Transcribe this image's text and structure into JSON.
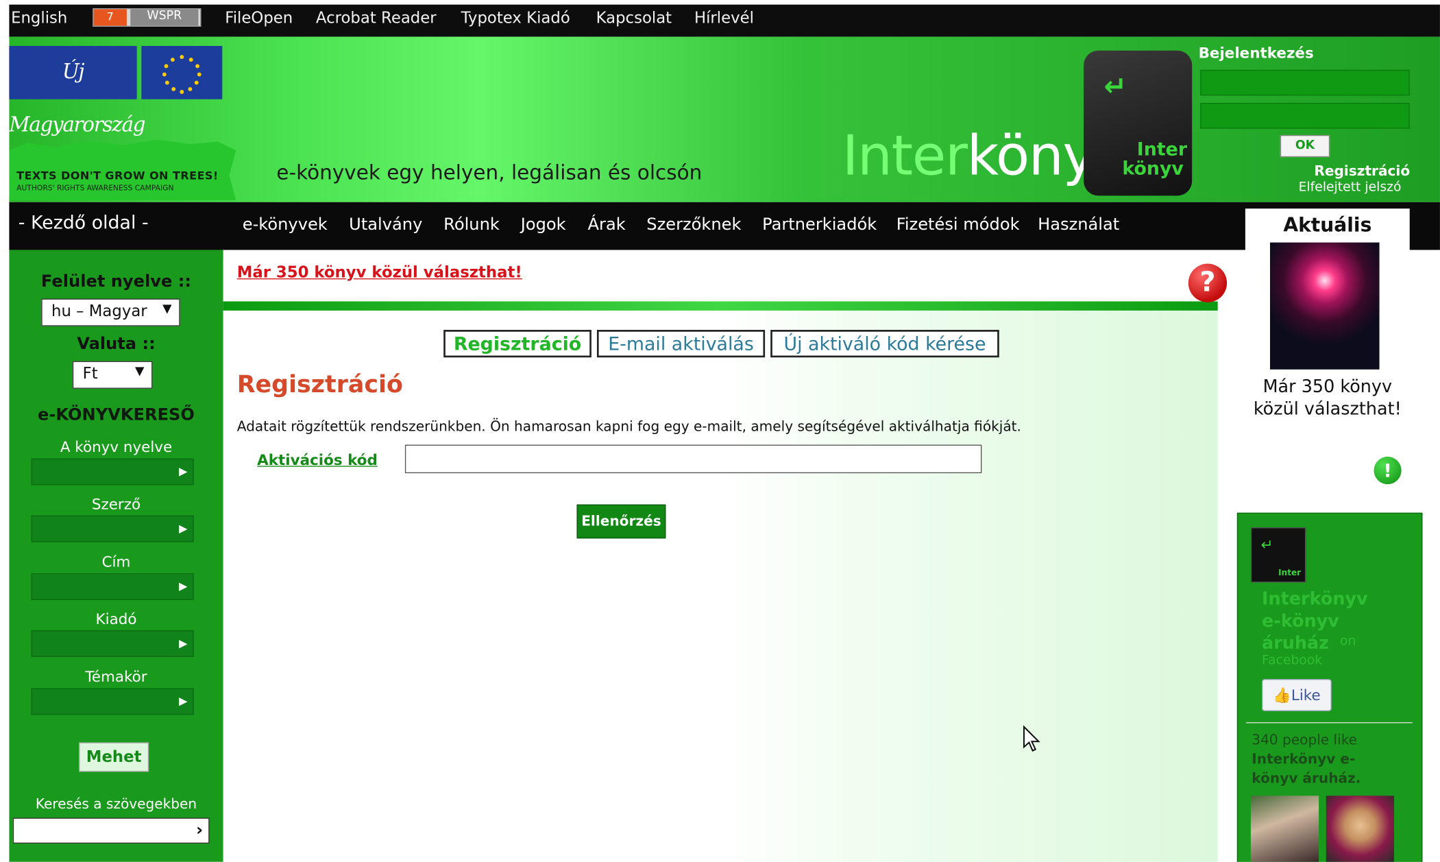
{
  "topbar": {
    "language_link": "English",
    "badge_number": "7",
    "badge_label": "WSPR",
    "links": [
      "FileOpen",
      "Acrobat Reader",
      "Typotex Kiadó",
      "Kapcsolat",
      "Hírlevél"
    ]
  },
  "header": {
    "logo_text": "Új Magyarország",
    "grow_title": "TEXTS DON'T GROW ON TREES!",
    "grow_subtitle": "AUTHORS' RIGHTS AWARENESS CAMPAIGN",
    "tagline": "e-könyvek egy helyen, legálisan és olcsón",
    "brand_part1": "Inter",
    "brand_part2": "könyv",
    "key_line1": "Inter",
    "key_line2": "könyv",
    "key_arrow": "↵"
  },
  "login": {
    "title": "Bejelentkezés",
    "username_value": "",
    "password_value": "",
    "ok_label": "OK",
    "register_link": "Regisztráció",
    "forgot_link": "Elfelejtett jelszó"
  },
  "nav": {
    "home": "- Kezdő oldal -",
    "items": [
      "e-könyvek",
      "Utalvány",
      "Rólunk",
      "Jogok",
      "Árak",
      "Szerzőknek",
      "Partnerkiadók",
      "Fizetési módok",
      "Használat"
    ]
  },
  "sidebar": {
    "ui_language_label": "Felület nyelve ::",
    "ui_language_value": "hu – Magyar",
    "currency_label": "Valuta ::",
    "currency_value": "Ft",
    "search_title": "e-KÖNYVKERESŐ",
    "filters": [
      "A könyv nyelve",
      "Szerző",
      "Cím",
      "Kiadó",
      "Témakör"
    ],
    "go_button": "Mehet",
    "fulltext_label": "Keresés a szövegekben",
    "fulltext_value": ""
  },
  "main": {
    "announcement": "Már 350 könyv közül választhat!",
    "help_icon": "?",
    "tabs": [
      {
        "label": "Regisztráció",
        "active": true
      },
      {
        "label": "E-mail aktiválás",
        "active": false
      },
      {
        "label": "Új aktiváló kód kérése",
        "active": false
      }
    ],
    "title": "Regisztráció",
    "info": "Adatait rögzítettük rendszerünkben. Ön hamarosan kapni fog egy e-mailt, amely segítségével aktiválhatja fiókját.",
    "code_label": "Aktivációs kód",
    "code_value": "",
    "check_button": "Ellenőrzés"
  },
  "right": {
    "aktualis_title": "Aktuális",
    "aktualis_text": "Már 350 könyv közül választhat!",
    "fb_name_lines": [
      "Interkönyv",
      "e-könyv",
      "áruház"
    ],
    "fb_on": "on",
    "fb_facebook": "Facebook",
    "like_label": "Like",
    "fb_count_line1": "340 people like",
    "fb_count_line2": "Interkönyv e-",
    "fb_count_line3": "könyv áruház."
  },
  "colors": {
    "brand_green": "#1a9a1d",
    "accent_red": "#d8121a",
    "title_orange": "#d44a2a"
  }
}
